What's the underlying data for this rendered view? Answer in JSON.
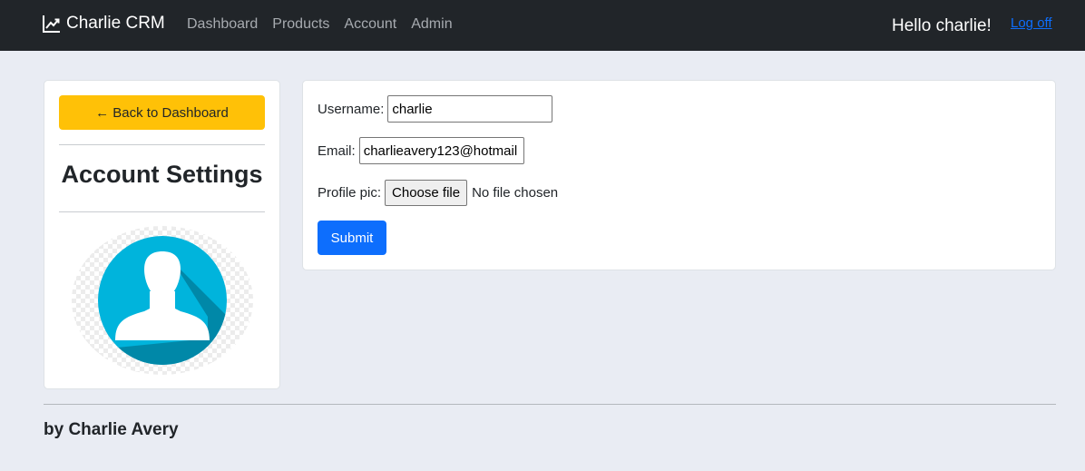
{
  "navbar": {
    "brand": "Charlie CRM",
    "brand_icon": "chart-line-icon",
    "links": [
      "Dashboard",
      "Products",
      "Account",
      "Admin"
    ],
    "greeting": "Hello charlie!",
    "logoff": "Log off"
  },
  "sidebar": {
    "back_button": "← Back to Dashboard",
    "title": "Account Settings",
    "avatar_icon": "user-avatar-icon"
  },
  "form": {
    "username_label": "Username:",
    "username_value": "charlie",
    "email_label": "Email:",
    "email_value": "charlieavery123@hotmail",
    "profile_pic_label": "Profile pic:",
    "choose_file_label": "Choose file",
    "no_file_text": "No file chosen",
    "submit_label": "Submit"
  },
  "footer": {
    "text": "by Charlie Avery"
  },
  "colors": {
    "navbar_bg": "#212529",
    "page_bg": "#e9ecf3",
    "warning": "#ffc107",
    "primary": "#0d6efd",
    "avatar_blue": "#00b4dc"
  }
}
